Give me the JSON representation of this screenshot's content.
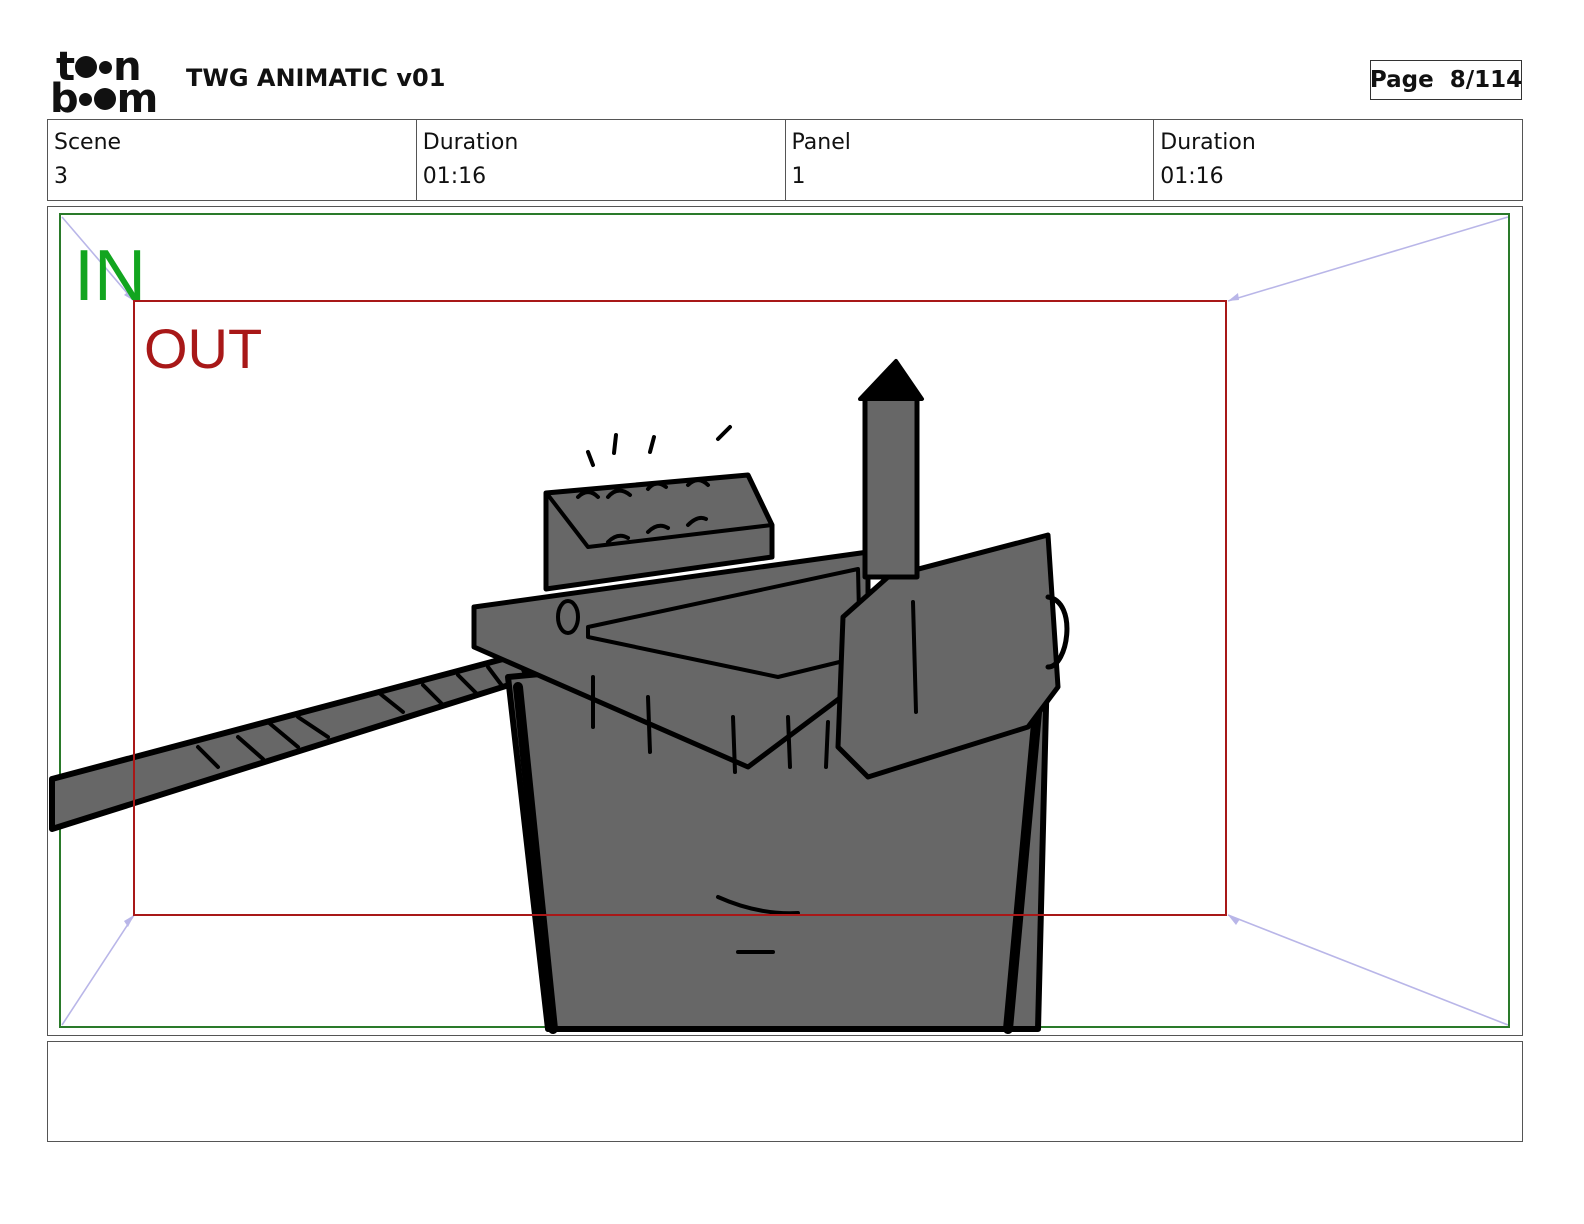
{
  "header": {
    "logo": {
      "top": "toon",
      "bottom": "boom"
    },
    "title": "TWG ANIMATIC v01",
    "page_label": "Page",
    "page_value": "8/114"
  },
  "info": {
    "scene_label": "Scene",
    "scene_value": "3",
    "scene_duration_label": "Duration",
    "scene_duration_value": "01:16",
    "panel_label": "Panel",
    "panel_value": "1",
    "panel_duration_label": "Duration",
    "panel_duration_value": "01:16"
  },
  "panel": {
    "in_label": "IN",
    "out_label": "OUT",
    "colors": {
      "in_frame": "#2a7a2a",
      "out_frame": "#a81818",
      "in_text": "#12a51f",
      "camera_lines": "#b9b6e8",
      "drawing_fill": "#676767"
    }
  },
  "notes": {
    "text": ""
  }
}
